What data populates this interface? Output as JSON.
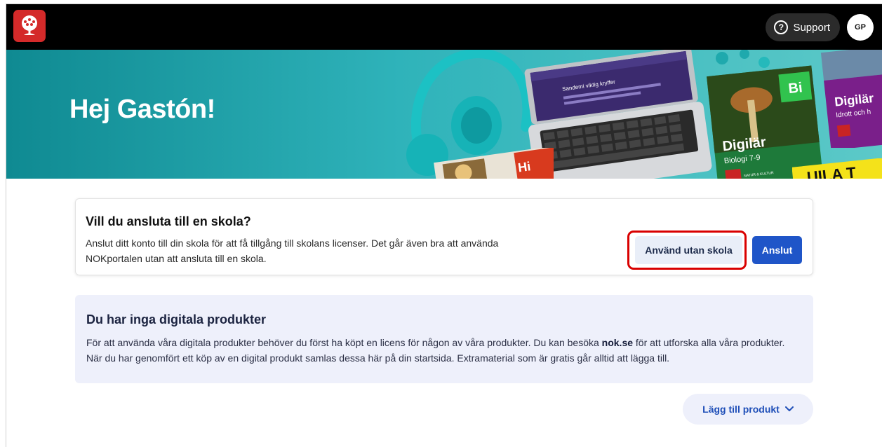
{
  "header": {
    "support_label": "Support",
    "support_icon": "question-circle-icon",
    "avatar_initials": "GP",
    "logo_icon": "tree-logo-icon"
  },
  "hero": {
    "greeting": "Hej Gastón!",
    "laptop_screen_text": "Sandemi viktig kryffer",
    "book1_badge": "Bi",
    "book1_brand": "Digilär",
    "book1_subtitle": "Biologi 7-9",
    "book2_brand": "Digilär",
    "book2_subtitle": "Idrott och h",
    "book3_badge": "Hi",
    "strip_text": "UILA T",
    "publisher_mark": "NATUR & KULTUR"
  },
  "connect_card": {
    "title": "Vill du ansluta till en skola?",
    "text": "Anslut ditt konto till din skola för att få tillgång till skolans licenser. Det går även bra att använda NOKportalen utan att ansluta till en skola.",
    "secondary_label": "Använd utan skola",
    "primary_label": "Anslut"
  },
  "products_info": {
    "title": "Du har inga digitala produkter",
    "text_before": "För att använda våra digitala produkter behöver du först ha köpt en licens för någon av våra produkter. Du kan besöka ",
    "link_text": "nok.se",
    "text_after": " för att utforska alla våra produkter. När du har genomfört ett köp av en digital produkt samlas dessa här på din startsida. Extramaterial som är gratis går alltid att lägga till."
  },
  "add_product": {
    "label": "Lägg till produkt",
    "icon": "chevron-down-icon"
  },
  "colors": {
    "accent": "#1f55c8",
    "logo_red": "#d42a2a",
    "highlight_ring": "#d90000",
    "hero_teal": "#2fb3ba"
  }
}
